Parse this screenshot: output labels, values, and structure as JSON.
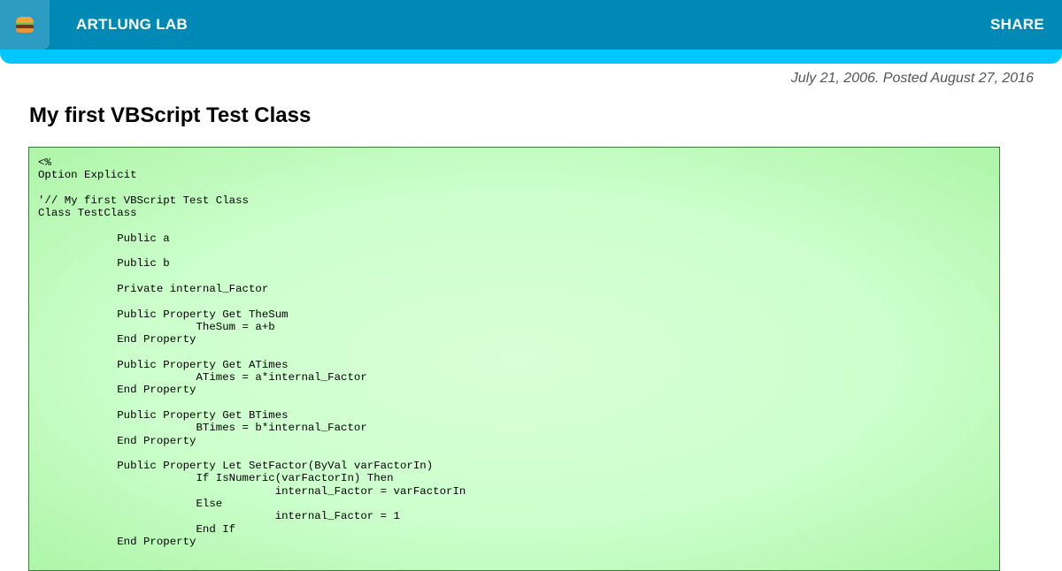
{
  "header": {
    "menu_icon": "hamburger-icon",
    "site_title": "ARTLUNG LAB",
    "share_label": "SHARE",
    "colors": {
      "bar": "#0089b4",
      "accent": "#00c8ff"
    }
  },
  "post": {
    "date_line": "July 21, 2006. Posted August 27, 2016",
    "title": "My first VBScript Test Class",
    "code": "<%\nOption Explicit\n\n'// My first VBScript Test Class\nClass TestClass\n\n\t\tPublic a\n\n\t\tPublic b\n\n\t\tPrivate internal_Factor\n\n\t\tPublic Property Get TheSum\n\t\t\t\tTheSum = a+b\n\t\tEnd Property\n\n\t\tPublic Property Get ATimes\n\t\t\t\tATimes = a*internal_Factor\n\t\tEnd Property\n\n\t\tPublic Property Get BTimes\n\t\t\t\tBTimes = b*internal_Factor\n\t\tEnd Property\n\n\t\tPublic Property Let SetFactor(ByVal varFactorIn)\n\t\t\t\tIf IsNumeric(varFactorIn) Then\n\t\t\t\t\t\tinternal_Factor = varFactorIn\n\t\t\t\tElse\n\t\t\t\t\t\tinternal_Factor = 1\n\t\t\t\tEnd If\n\t\tEnd Property",
    "code_colors": {
      "background": "#ccffcc",
      "border": "#3a7a3a"
    }
  }
}
